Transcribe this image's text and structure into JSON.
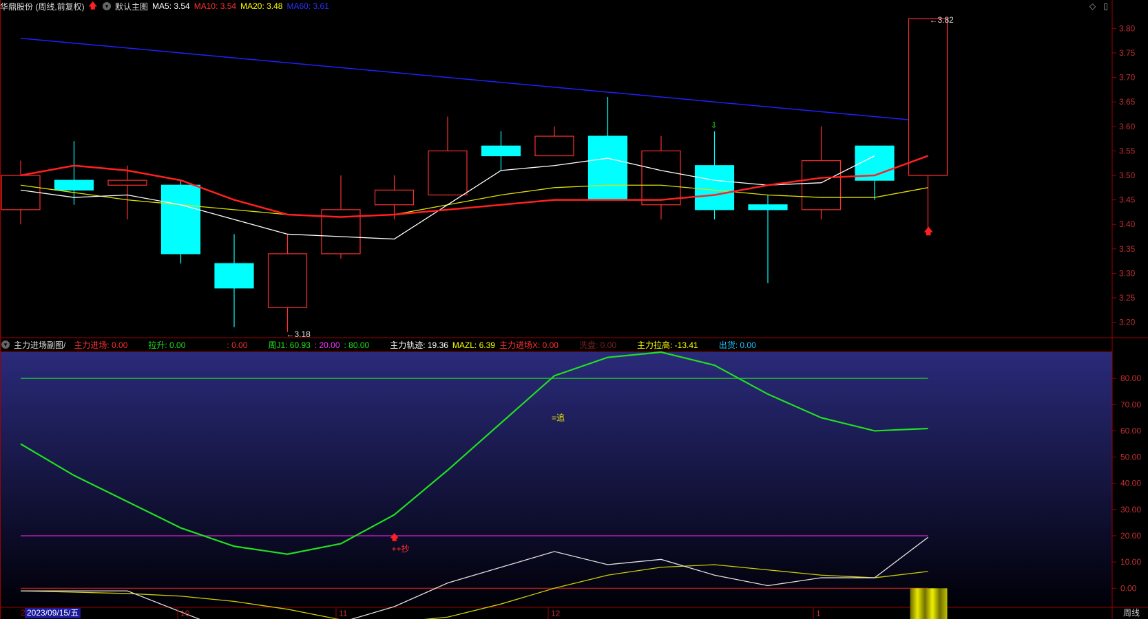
{
  "header": {
    "stock_title": "华鼎股份 (周线,前复权)",
    "chart_name": "默认主图",
    "ma": [
      {
        "label": "MA5: 3.54",
        "color": "#ffffff"
      },
      {
        "label": "MA10: 3.54",
        "color": "#ff3030"
      },
      {
        "label": "MA20: 3.48",
        "color": "#ffff00"
      },
      {
        "label": "MA60: 3.61",
        "color": "#3030ff"
      }
    ],
    "tool_diamond": "◇",
    "tool_square": "▯"
  },
  "indicator_bar": {
    "name": "主力进场副图/",
    "items": [
      {
        "label": "主力进场: 0.00",
        "color": "#ff3030"
      },
      {
        "label": "拉升: 0.00",
        "color": "#20e020"
      },
      {
        "label": ": 0.00",
        "color": "#ff3030"
      },
      {
        "label": "周J1: 60.93",
        "color": "#20e020"
      },
      {
        "label": ": 20.00",
        "color": "#ff30ff"
      },
      {
        "label": ": 80.00",
        "color": "#20e020"
      },
      {
        "label": "主力轨迹: 19.36",
        "color": "#ffffff"
      },
      {
        "label": "MAZL: 6.39",
        "color": "#ffff00"
      },
      {
        "label": "主力进场X: 0.00",
        "color": "#ff3030"
      },
      {
        "label": "洗盘: 0.00",
        "color": "#7a2020"
      },
      {
        "label": "主力拉高: -13.41",
        "color": "#ffff00"
      },
      {
        "label": "出货: 0.00",
        "color": "#20c0ff"
      }
    ]
  },
  "price_axis": [
    "3.80",
    "3.75",
    "3.70",
    "3.65",
    "3.60",
    "3.55",
    "3.50",
    "3.45",
    "3.40",
    "3.35",
    "3.30",
    "3.25",
    "3.20"
  ],
  "sub_axis": [
    "80.00",
    "70.00",
    "60.00",
    "50.00",
    "40.00",
    "30.00",
    "20.00",
    "10.00",
    "0.00"
  ],
  "annotations": {
    "high_label": "3.82",
    "low_label": "3.18",
    "chase_label": "=追",
    "buy_label": "++抄"
  },
  "x_axis": {
    "date_box": "2023/09/15/五",
    "first_digit": "2",
    "months": [
      "10",
      "11",
      "12",
      "1"
    ],
    "period": "周线"
  },
  "colors": {
    "up": "#ff3030",
    "down": "#00ffff",
    "ma5": "#ffffff",
    "ma10": "#ff2020",
    "ma20": "#e0e000",
    "ma60": "#2020ff",
    "j_line": "#20e020"
  },
  "chart_data": {
    "type": "candlestick",
    "candles": [
      {
        "o": 3.43,
        "c": 3.5,
        "h": 3.53,
        "l": 3.4
      },
      {
        "o": 3.49,
        "c": 3.47,
        "h": 3.57,
        "l": 3.44
      },
      {
        "o": 3.48,
        "c": 3.49,
        "h": 3.52,
        "l": 3.41
      },
      {
        "o": 3.48,
        "c": 3.34,
        "h": 3.49,
        "l": 3.32
      },
      {
        "o": 3.32,
        "c": 3.27,
        "h": 3.38,
        "l": 3.19
      },
      {
        "o": 3.23,
        "c": 3.34,
        "h": 3.38,
        "l": 3.18
      },
      {
        "o": 3.34,
        "c": 3.43,
        "h": 3.5,
        "l": 3.33
      },
      {
        "o": 3.44,
        "c": 3.47,
        "h": 3.5,
        "l": 3.41
      },
      {
        "o": 3.46,
        "c": 3.55,
        "h": 3.62,
        "l": 3.46
      },
      {
        "o": 3.56,
        "c": 3.54,
        "h": 3.59,
        "l": 3.51
      },
      {
        "o": 3.54,
        "c": 3.58,
        "h": 3.6,
        "l": 3.54
      },
      {
        "o": 3.58,
        "c": 3.45,
        "h": 3.66,
        "l": 3.45
      },
      {
        "o": 3.44,
        "c": 3.55,
        "h": 3.58,
        "l": 3.41
      },
      {
        "o": 3.52,
        "c": 3.43,
        "h": 3.59,
        "l": 3.41
      },
      {
        "o": 3.44,
        "c": 3.43,
        "h": 3.46,
        "l": 3.28
      },
      {
        "o": 3.43,
        "c": 3.53,
        "h": 3.6,
        "l": 3.41
      },
      {
        "o": 3.56,
        "c": 3.49,
        "h": 3.56,
        "l": 3.45
      },
      {
        "o": 3.5,
        "c": 3.82,
        "h": 3.82,
        "l": 3.39
      }
    ],
    "ma5": [
      3.47,
      3.455,
      3.46,
      3.44,
      3.41,
      3.38,
      3.375,
      3.37,
      3.44,
      3.51,
      3.52,
      3.535,
      3.51,
      3.49,
      3.48,
      3.485,
      3.54
    ],
    "ma10": [
      3.5,
      3.52,
      3.51,
      3.49,
      3.45,
      3.42,
      3.415,
      3.42,
      3.43,
      3.44,
      3.45,
      3.45,
      3.45,
      3.46,
      3.48,
      3.495,
      3.5,
      3.54
    ],
    "ma20": [
      3.48,
      3.465,
      3.45,
      3.44,
      3.43,
      3.42,
      3.415,
      3.42,
      3.44,
      3.46,
      3.475,
      3.48,
      3.48,
      3.47,
      3.46,
      3.455,
      3.455,
      3.475
    ],
    "ma60_start": 3.78,
    "ma60_end": 3.61,
    "y_range": [
      3.17,
      3.83
    ],
    "sub": {
      "y_range": [
        -7,
        90
      ],
      "j": [
        55,
        43,
        33,
        23,
        16,
        13,
        17,
        28,
        45,
        63,
        81,
        88,
        90,
        85,
        74,
        65,
        60,
        60.9
      ],
      "trace": [
        -1,
        -1,
        -1,
        -9,
        -17,
        -18,
        -13,
        -7,
        2,
        8,
        14,
        9,
        11,
        5,
        1,
        4,
        4,
        19.4
      ],
      "mazl": [
        -1,
        -1.5,
        -2,
        -3,
        -5,
        -8,
        -12,
        -13,
        -11,
        -6,
        0,
        5,
        8,
        9,
        7,
        5,
        4,
        6.4
      ],
      "lines": [
        80,
        20,
        0
      ]
    }
  }
}
